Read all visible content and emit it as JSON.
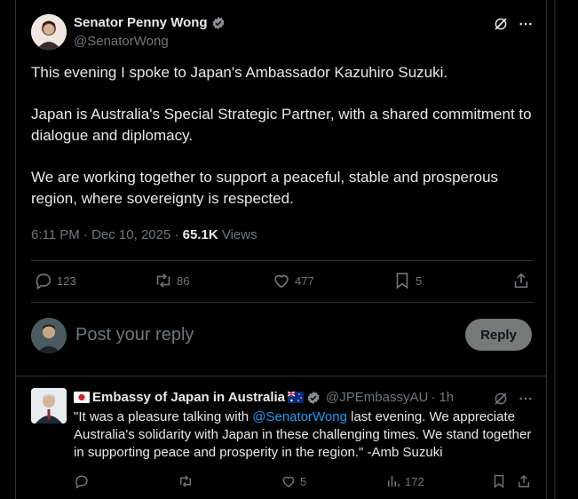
{
  "post": {
    "author_name": "Senator Penny Wong",
    "author_handle": "@SenatorWong",
    "paragraphs": [
      "This evening I spoke to Japan's Ambassador Kazuhiro Suzuki.",
      "Japan is Australia's Special Strategic Partner, with a shared commitment to dialogue and diplomacy.",
      "We are working together to support a peaceful, stable and prosperous region, where sovereignty is respected."
    ],
    "timestamp": "6:11 PM · Dec 10, 2025 · ",
    "views_count": "65.1K",
    "views_label": " Views",
    "actions": {
      "replies": "123",
      "reposts": "86",
      "likes": "477",
      "bookmarks": "5"
    }
  },
  "composer": {
    "placeholder": "Post your reply",
    "button_label": "Reply"
  },
  "reply": {
    "author_name": "Embassy of Japan in Australia",
    "author_handle": "@JPEmbassyAU",
    "time": " · 1h",
    "text_before": "\"It was a pleasure talking with ",
    "mention": "@SenatorWong",
    "text_after": " last evening. We appreciate Australia's solidarity with Japan in these challenging times. We stand together in supporting peace and prosperity in the region.\" -Amb Suzuki",
    "actions": {
      "likes": "5",
      "views": "172"
    }
  },
  "colors": {
    "background": "#000000",
    "text": "#e7e9ea",
    "muted": "#71767b",
    "accent": "#1d9bf0",
    "divider": "#2f3336",
    "reply_button": "#787a7a"
  },
  "icons": [
    "verified-badge-icon",
    "grok-icon",
    "more-icon",
    "reply-icon",
    "repost-icon",
    "like-icon",
    "bookmark-icon",
    "share-icon",
    "views-icon",
    "japan-flag-icon",
    "australia-flag-icon"
  ]
}
